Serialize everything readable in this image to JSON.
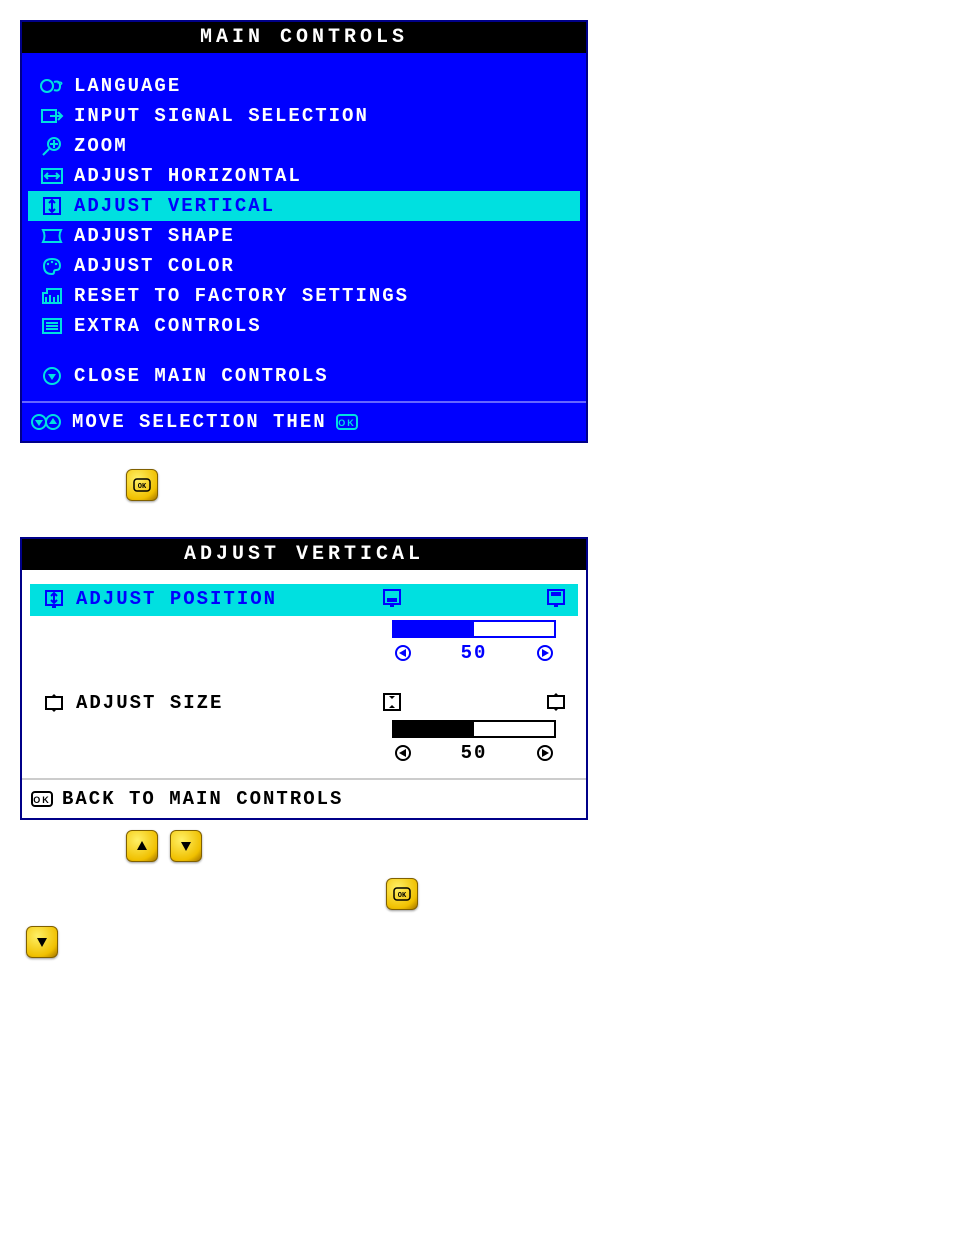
{
  "main": {
    "title": "MAIN CONTROLS",
    "items": [
      {
        "icon": "language-icon",
        "label": "LANGUAGE",
        "selected": false
      },
      {
        "icon": "input-icon",
        "label": "INPUT SIGNAL SELECTION",
        "selected": false
      },
      {
        "icon": "zoom-icon",
        "label": "ZOOM",
        "selected": false
      },
      {
        "icon": "adj-horiz-icon",
        "label": "ADJUST HORIZONTAL",
        "selected": false
      },
      {
        "icon": "adj-vert-icon",
        "label": "ADJUST VERTICAL",
        "selected": true
      },
      {
        "icon": "adj-shape-icon",
        "label": "ADJUST SHAPE",
        "selected": false
      },
      {
        "icon": "adj-color-icon",
        "label": "ADJUST COLOR",
        "selected": false
      },
      {
        "icon": "reset-icon",
        "label": "RESET TO FACTORY SETTINGS",
        "selected": false
      },
      {
        "icon": "extra-icon",
        "label": "EXTRA CONTROLS",
        "selected": false
      }
    ],
    "close_label": "CLOSE MAIN CONTROLS",
    "footer_hint": "MOVE SELECTION THEN"
  },
  "sub": {
    "title": "ADJUST VERTICAL",
    "items": [
      {
        "label": "ADJUST POSITION",
        "value": 50,
        "selected": true
      },
      {
        "label": "ADJUST SIZE",
        "value": 50,
        "selected": false
      }
    ],
    "back_label": "BACK TO MAIN CONTROLS"
  }
}
